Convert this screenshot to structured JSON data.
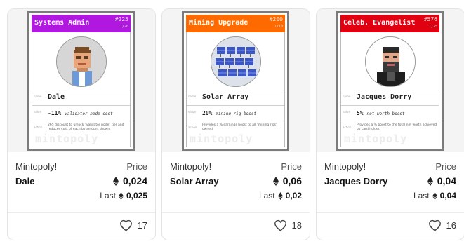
{
  "cards": [
    {
      "header_color": "#b018e0",
      "card_title": "Systems Admin",
      "card_number": "#225",
      "edition": "1/20",
      "name_label": "name",
      "card_name": "Dale",
      "boost_label": "value",
      "boost_value": "-11%",
      "boost_text": "validator node cost",
      "action_label": "action",
      "action_text": "265 discount to unlock \"validator node\" tier and reduces cost of each by amount shown.",
      "watermark": "mintopoly",
      "collection": "Mintopoly!",
      "price_label": "Price",
      "name": "Dale",
      "price": "0,024",
      "last_label": "Last",
      "last_price": "0,025",
      "likes": "17",
      "portrait": "man-with-glasses-avatar"
    },
    {
      "header_color": "#ff6a00",
      "card_title": "Mining Upgrade",
      "card_number": "#200",
      "edition": "1/10",
      "name_label": "name",
      "card_name": "Solar Array",
      "boost_label": "value",
      "boost_value": "20%",
      "boost_text": "mining rig boost",
      "action_label": "action",
      "action_text": "Provides a % earnings boost to all \"mining rigs\" owned.",
      "watermark": "mintopoly",
      "collection": "Mintopoly!",
      "price_label": "Price",
      "name": "Solar Array",
      "price": "0,06",
      "last_label": "Last",
      "last_price": "0,02",
      "likes": "18",
      "portrait": "solar-panels-image"
    },
    {
      "header_color": "#e00010",
      "card_title": "Celeb. Evangelist",
      "card_number": "#576",
      "edition": "1/25",
      "name_label": "name",
      "card_name": "Jacques Dorry",
      "boost_label": "value",
      "boost_value": "5%",
      "boost_text": "net worth boost",
      "action_label": "action",
      "action_text": "Provides a % boost to the total net worth achieved by card holder.",
      "watermark": "mintopoly",
      "collection": "Mintopoly!",
      "price_label": "Price",
      "name": "Jacques Dorry",
      "price": "0,04",
      "last_label": "Last",
      "last_price": "0,04",
      "likes": "16",
      "portrait": "bearded-man-avatar"
    }
  ]
}
